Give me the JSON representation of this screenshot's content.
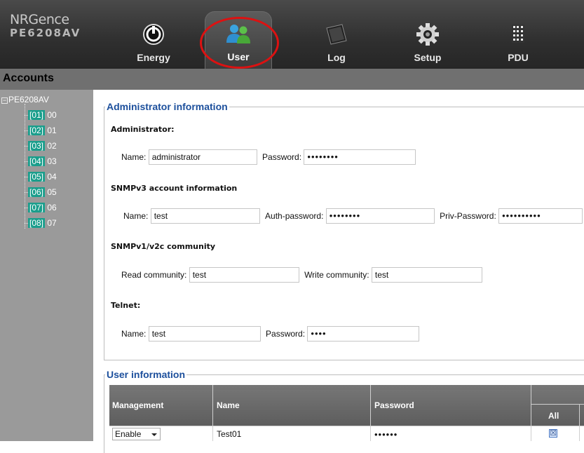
{
  "logo": {
    "brand": "NRGence",
    "model": "PE6208AV"
  },
  "nav": {
    "tabs": [
      {
        "label": "Energy",
        "icon": "power-icon"
      },
      {
        "label": "User",
        "icon": "users-icon"
      },
      {
        "label": "Log",
        "icon": "log-icon"
      },
      {
        "label": "Setup",
        "icon": "gear-icon"
      },
      {
        "label": "PDU",
        "icon": "pdu-icon"
      }
    ],
    "active": "User",
    "highlight_color": "#d11111"
  },
  "subbar": {
    "title": "Accounts"
  },
  "tree": {
    "root": "PE6208AV",
    "items": [
      {
        "id": "[01]",
        "name": "00"
      },
      {
        "id": "[02]",
        "name": "01"
      },
      {
        "id": "[03]",
        "name": "02"
      },
      {
        "id": "[04]",
        "name": "03"
      },
      {
        "id": "[05]",
        "name": "04"
      },
      {
        "id": "[06]",
        "name": "05"
      },
      {
        "id": "[07]",
        "name": "06"
      },
      {
        "id": "[08]",
        "name": "07"
      }
    ]
  },
  "admin_info": {
    "legend": "Administrator information",
    "administrator": {
      "heading": "Administrator:",
      "name_label": "Name:",
      "name_value": "administrator",
      "password_label": "Password:",
      "password_value": "••••••••"
    },
    "snmpv3": {
      "heading": "SNMPv3 account information",
      "name_label": "Name:",
      "name_value": "test",
      "auth_label": "Auth-password:",
      "auth_value": "••••••••",
      "priv_label": "Priv-Password:",
      "priv_value": "••••••••••"
    },
    "snmpv1": {
      "heading": "SNMPv1/v2c community",
      "read_label": "Read community:",
      "read_value": "test",
      "write_label": "Write community:",
      "write_value": "test"
    },
    "telnet": {
      "heading": "Telnet:",
      "name_label": "Name:",
      "name_value": "test",
      "password_label": "Password:",
      "password_value": "••••"
    }
  },
  "user_info": {
    "legend": "User information",
    "columns": {
      "management": "Management",
      "name": "Name",
      "password": "Password",
      "all": "All"
    },
    "rows": [
      {
        "management": "Enable",
        "name": "Test01",
        "password": "••••••",
        "all_checked": "☒"
      }
    ]
  },
  "colors": {
    "accent": "#1c4f9c",
    "badge": "#1a9e8c",
    "topbar": "#2f2f2f"
  }
}
